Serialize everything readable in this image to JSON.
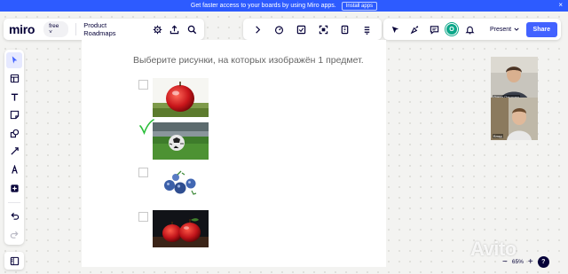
{
  "banner": {
    "text": "Get faster access to your boards by using Miro apps.",
    "install_label": "Install apps",
    "close_glyph": "×"
  },
  "header": {
    "logo": "miro",
    "plan": "free",
    "board_title": "Product Roadmaps",
    "present_label": "Present",
    "share_label": "Share",
    "avatar_initial": "O"
  },
  "colors": {
    "banner": "#2d5bff",
    "share": "#4262ff",
    "avatar": "#0ca789",
    "checkmark": "#2bbf3a"
  },
  "toolbar_icons": {
    "top_left": [
      "settings-icon",
      "upload-icon",
      "search-icon"
    ],
    "top_center": [
      "chevron-right-icon",
      "timer-icon",
      "sticky-note-icon",
      "frame-icon",
      "card-icon",
      "more-icon"
    ],
    "top_right": [
      "cursor-icon",
      "reactions-icon",
      "comment-icon",
      "bell-icon"
    ],
    "left": [
      "select-icon",
      "templates-icon",
      "text-icon",
      "sticky-icon",
      "shapes-icon",
      "connector-icon",
      "pen-icon",
      "add-icon",
      "undo-icon",
      "redo-icon"
    ]
  },
  "document": {
    "question": "Выберите рисунки, на которых изображён 1 предмет.",
    "options": [
      {
        "checked": false,
        "image": "single-apple-photo"
      },
      {
        "checked": true,
        "image": "football-ball-photo"
      },
      {
        "checked": false,
        "image": "blue-berries-photo"
      },
      {
        "checked": false,
        "image": "two-apples-photo"
      }
    ]
  },
  "videos": [
    {
      "name": "Ольга Пашкова"
    },
    {
      "name": "Влад"
    }
  ],
  "zoom": {
    "level": "65%",
    "minus": "−",
    "plus": "+",
    "help": "?"
  },
  "watermark": "Avito"
}
